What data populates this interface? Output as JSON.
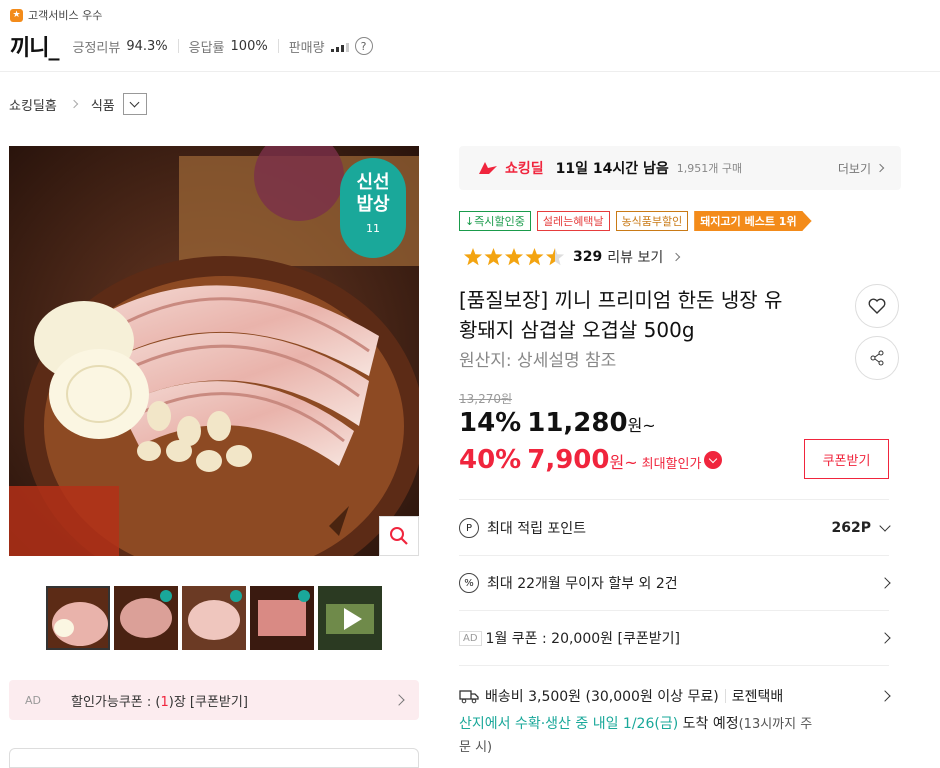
{
  "seller": {
    "badge": "고객서비스 우수",
    "name": "끼니_",
    "review_label": "긍정리뷰",
    "review_value": "94.3%",
    "response_label": "응답률",
    "response_value": "100%",
    "sales_label": "판매량",
    "help_glyph": "?"
  },
  "breadcrumb": {
    "home": "쇼킹딜홈",
    "category": "식품"
  },
  "image_overlay": {
    "line1": "신선",
    "line2": "밥상",
    "line3": "11"
  },
  "deal": {
    "brand": "쇼킹딜",
    "time_left": "11일 14시간 남음",
    "purchases": "1,951개 구매",
    "more": "더보기"
  },
  "tags": [
    {
      "label": "↓즉시할인중",
      "color": "#1a9b4b"
    },
    {
      "label": "설레는혜택날",
      "color": "#e63c3c"
    },
    {
      "label": "농식품부할인",
      "color": "#c97a16"
    },
    {
      "label": "돼지고기 베스트 1위",
      "color": "#f38b1a"
    }
  ],
  "rating": {
    "score": 4.5,
    "count": "329",
    "label": "리뷰 보기"
  },
  "product": {
    "title_line1": "[품질보장] 끼니 프리미엄 한돈 냉장 유",
    "title_line2": "황돼지 삼겹살 오겹살 500g",
    "origin": "원산지: 상세설명 참조"
  },
  "price": {
    "original": "13,270원",
    "disc1_rate": "14%",
    "disc1_price": "11,280",
    "won1": "원~",
    "disc2_rate": "40%",
    "disc2_price": "7,900",
    "won2": "원~",
    "max_label": "최대할인가",
    "coupon_button": "쿠폰받기"
  },
  "points": {
    "label": "최대 적립 포인트",
    "value": "262P"
  },
  "installment": {
    "label": "최대 22개월 무이자 할부 외 2건"
  },
  "coupon_row": {
    "ad": "AD",
    "text": "1월 쿠폰 : 20,000원 [쿠폰받기]"
  },
  "shipping": {
    "fee": "배송비 3,500원 (30,000원 이상 무료)",
    "carrier": "로젠택배",
    "eta_green": "산지에서 수확·생산 중 내일 1/26(금)",
    "eta_rest": " 도착 예정",
    "eta_note": "(13시까지 주",
    "eta_note2": "문 시)"
  },
  "coupon_bar": {
    "ad": "AD",
    "text_a": "할인가능쿠폰 : (",
    "count": "1",
    "text_b": ")장 [쿠폰받기]"
  }
}
